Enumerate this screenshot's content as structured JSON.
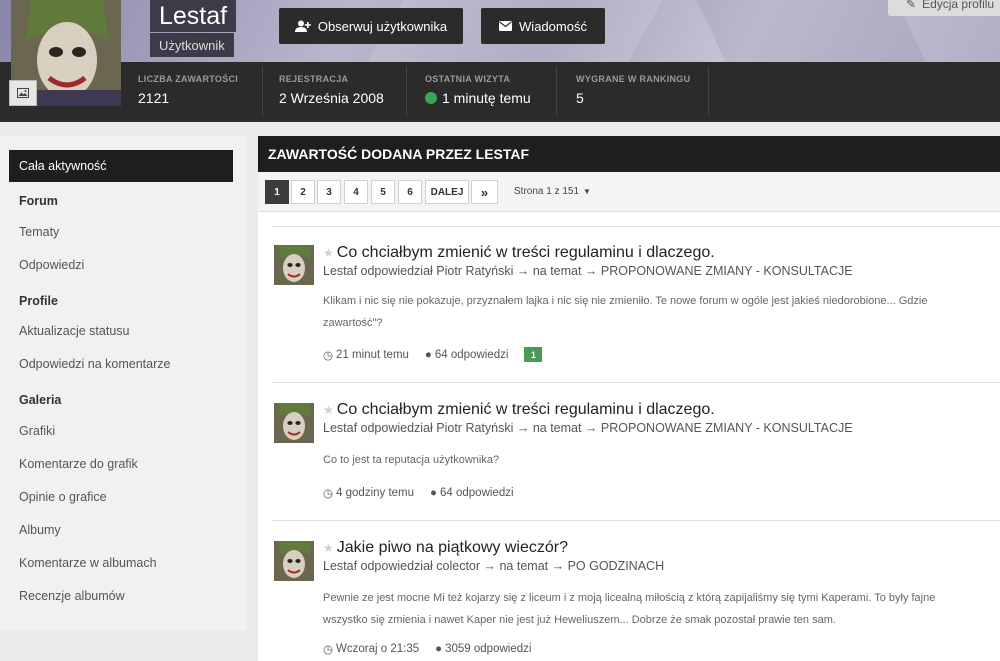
{
  "profile": {
    "name": "Lestaf",
    "role": "Użytkownik",
    "follow_label": "Obserwuj użytkownika",
    "message_label": "Wiadomość",
    "edit_label": "Edycja profilu",
    "stats": [
      {
        "label": "LICZBA ZAWARTOŚCI",
        "value": "2121"
      },
      {
        "label": "REJESTRACJA",
        "value": "2 Września 2008"
      },
      {
        "label": "OSTATNIA WIZYTA",
        "value": "1 minutę temu"
      },
      {
        "label": "WYGRANE W RANKINGU",
        "value": "5"
      }
    ]
  },
  "sidebar": {
    "active": "Cała aktywność",
    "groups": [
      {
        "title": "Forum",
        "items": [
          "Tematy",
          "Odpowiedzi"
        ]
      },
      {
        "title": "Profile",
        "items": [
          "Aktualizacje statusu",
          "Odpowiedzi na komentarze"
        ]
      },
      {
        "title": "Galeria",
        "items": [
          "Grafiki",
          "Komentarze do grafik",
          "Opinie o grafice",
          "Albumy",
          "Komentarze w albumach",
          "Recenzje albumów"
        ]
      }
    ]
  },
  "main": {
    "title": "ZAWARTOŚĆ DODANA PRZEZ LESTAF",
    "pager": {
      "pages": [
        "1",
        "2",
        "3",
        "4",
        "5",
        "6"
      ],
      "next_label": "DALEJ",
      "last_label": "»",
      "page_info": "Strona 1 z 151"
    },
    "items": [
      {
        "title": "Co chciałbym zmienić w treści regulaminu i dlaczego.",
        "meta": "Lestaf odpowiedział Piotr Ratyński → na temat → PROPONOWANE ZMIANY - KONSULTACJE",
        "body": [
          "Klikam i nic się nie pokazuje, przyznałem lajka i nic się nie zmieniło. Te nowe forum w ogóle jest jakieś niedorobione... Gdzie",
          "zawartość\"?"
        ],
        "time": "21 minut temu",
        "replies": "64 odpowiedzi",
        "reputation": "1"
      },
      {
        "title": "Co chciałbym zmienić w treści regulaminu i dlaczego.",
        "meta": "Lestaf odpowiedział Piotr Ratyński → na temat → PROPONOWANE ZMIANY - KONSULTACJE",
        "body": [
          "Co to jest ta reputacja użytkownika?"
        ],
        "time": "4 godziny temu",
        "replies": "64 odpowiedzi"
      },
      {
        "title": "Jakie piwo na piątkowy wieczór?",
        "meta": "Lestaf odpowiedział colector → na temat → PO GODZINACH",
        "body": [
          "Pewnie ze jest mocne Mi też kojarzy się z liceum i z moją licealną miłością z którą zapijaliśmy się tymi Kaperami. To były fajne",
          "wszystko się zmienia i nawet Kaper nie jest już Heweliuszem... Dobrze że smak pozostał prawie ten sam."
        ],
        "time": "Wczoraj o 21:35",
        "replies": "3059 odpowiedzi"
      }
    ]
  },
  "icons": {
    "follow": "user-plus-icon",
    "message": "envelope-icon",
    "edit": "pencil-icon",
    "photo": "image-icon",
    "clock": "clock-icon",
    "comment": "comment-icon",
    "star": "star-icon"
  },
  "colors": {
    "online": "#3aa655",
    "reputation": "#4a9a56",
    "dark_bar": "#2b2b2b"
  }
}
